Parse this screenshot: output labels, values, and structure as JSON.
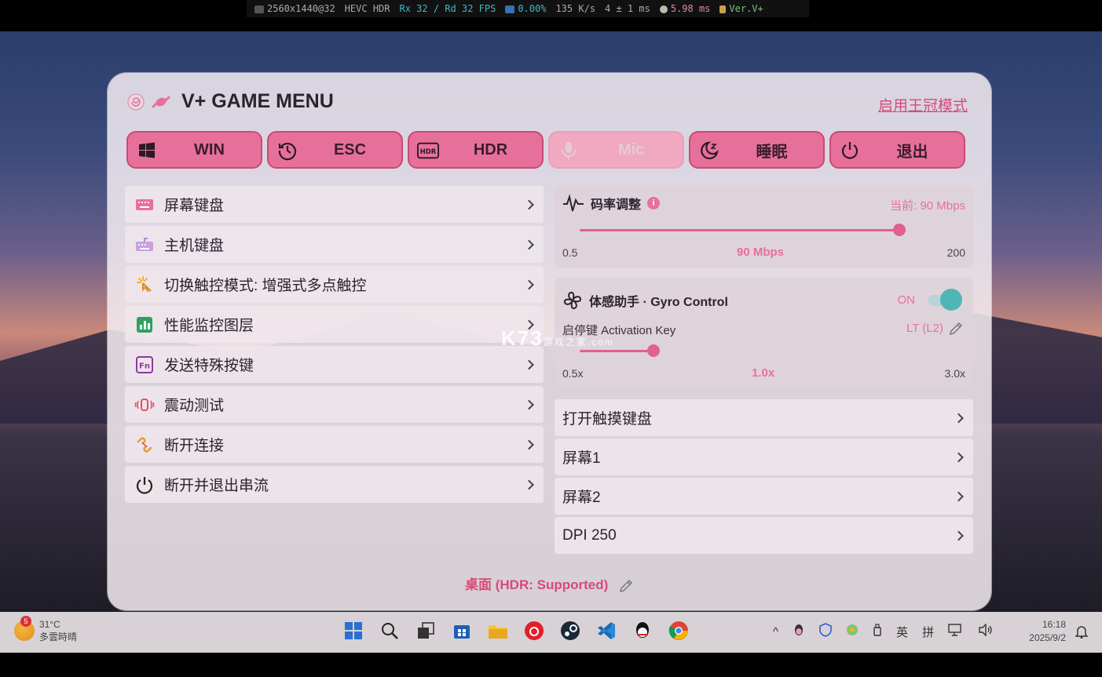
{
  "stats": {
    "resolution": "2560x1440@32",
    "codec": "HEVC HDR",
    "fps": "Rx 32 / Rd 32 FPS",
    "loss": "0.00%",
    "bandwidth": "135 K/s",
    "latency": "4 ± 1 ms",
    "decode": "5.98 ms",
    "version": "Ver.V+"
  },
  "menu": {
    "title": "V+ GAME MENU",
    "crown_link": "启用王冠模式",
    "quick_buttons": [
      {
        "label": "WIN",
        "icon": "windows-icon",
        "enabled": true
      },
      {
        "label": "ESC",
        "icon": "history-icon",
        "enabled": true
      },
      {
        "label": "HDR",
        "icon": "hdr-icon",
        "enabled": true
      },
      {
        "label": "Mic",
        "icon": "microphone-icon",
        "enabled": false
      },
      {
        "label": "睡眠",
        "icon": "sleep-moon-icon",
        "enabled": true
      },
      {
        "label": "退出",
        "icon": "power-icon",
        "enabled": true
      }
    ],
    "left_items": [
      {
        "label": "屏幕键盘",
        "icon": "keyboard-icon"
      },
      {
        "label": "主机键盘",
        "icon": "host-keyboard-icon"
      },
      {
        "label": "切换触控模式: 增强式多点触控",
        "icon": "touch-icon"
      },
      {
        "label": "性能监控图层",
        "icon": "chart-icon"
      },
      {
        "label": "发送特殊按键",
        "icon": "fn-key-icon"
      },
      {
        "label": "震动测试",
        "icon": "vibration-icon"
      },
      {
        "label": "断开连接",
        "icon": "unlink-icon"
      },
      {
        "label": "断开并退出串流",
        "icon": "power-icon"
      }
    ],
    "bitrate": {
      "title": "码率调整",
      "current": "当前: 90 Mbps",
      "min": "0.5",
      "max": "200",
      "value_label": "90 Mbps",
      "value": 90,
      "range": [
        0.5,
        200
      ]
    },
    "gyro": {
      "title": "体感助手 · Gyro Control",
      "state": "ON",
      "enabled": true,
      "activation_label": "启停键 Activation Key",
      "activation_value": "LT (L2)",
      "min": "0.5x",
      "max": "3.0x",
      "value_label": "1.0x",
      "value": 1.0,
      "range": [
        0.5,
        3.0
      ]
    },
    "right_items": [
      {
        "label": "打开触摸键盘"
      },
      {
        "label": "屏幕1"
      },
      {
        "label": "屏幕2"
      },
      {
        "label": "DPI 250"
      }
    ],
    "footer": "桌面 (HDR: Supported)"
  },
  "watermark": {
    "main": "K73",
    "sub": "游戏之家",
    "domain": ".com"
  },
  "taskbar": {
    "weather_badge": "5",
    "temperature": "31°C",
    "condition": "多雲時晴",
    "tray_lang1": "英",
    "tray_lang2": "拼",
    "time": "16:18",
    "date": "2025/9/2"
  },
  "colors": {
    "accent": "#e7709a",
    "accent_dark": "#c94a76",
    "toggle": "#4fb6b8"
  }
}
